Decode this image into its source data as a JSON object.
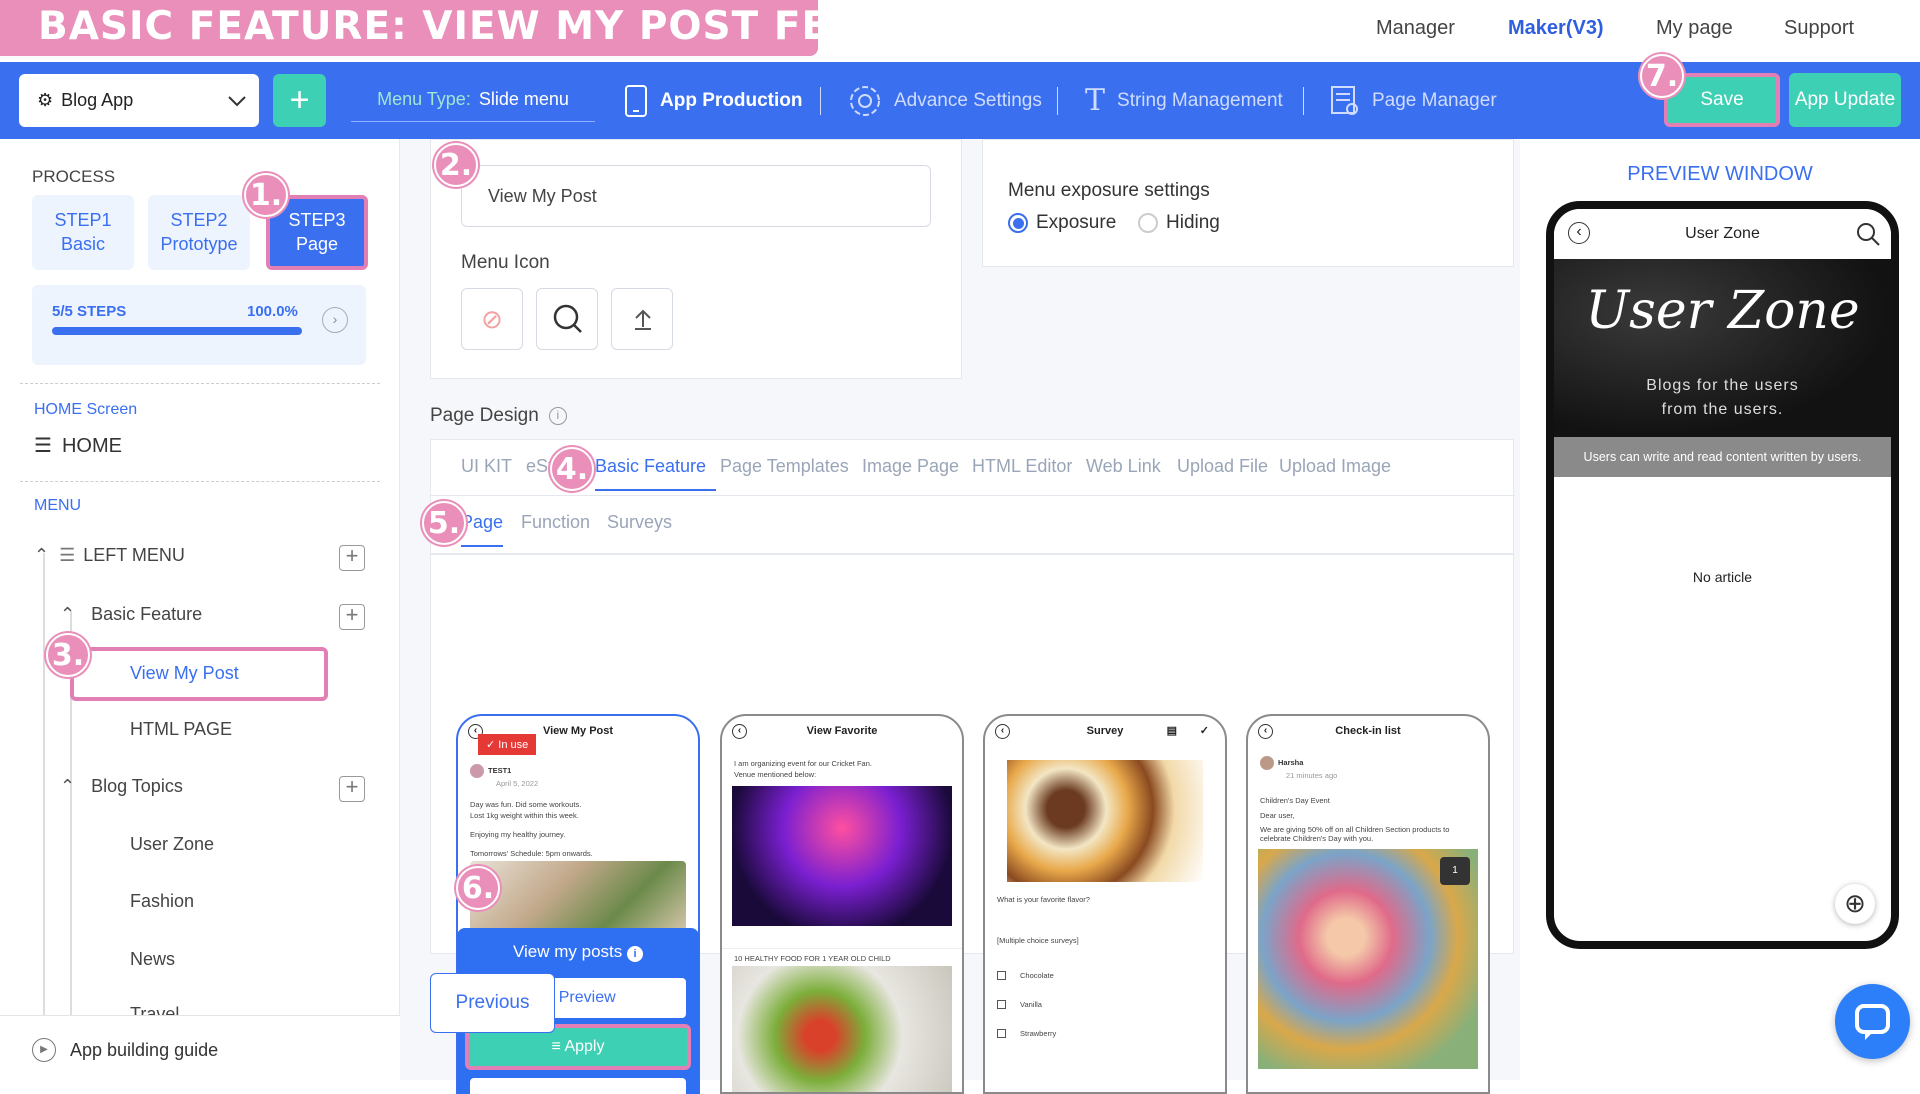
{
  "banner": {
    "title": "BASIC FEATURE: VIEW MY POST FEATURE"
  },
  "topnav": {
    "manager": "Manager",
    "maker": "Maker(V3)",
    "mypage": "My page",
    "support": "Support"
  },
  "toolbar": {
    "app_name": "Blog App",
    "add": "+",
    "menu_type_label": "Menu Type:",
    "menu_type_value": "Slide menu",
    "app_production": "App Production",
    "advance_settings": "Advance Settings",
    "string_management": "String Management",
    "page_manager": "Page Manager",
    "save": "Save",
    "app_update": "App Update"
  },
  "badges": [
    "1.",
    "2.",
    "3.",
    "4.",
    "5.",
    "6.",
    "7."
  ],
  "sidebar": {
    "process_label": "PROCESS",
    "steps": [
      {
        "line1": "STEP1",
        "line2": "Basic"
      },
      {
        "line1": "STEP2",
        "line2": "Prototype"
      },
      {
        "line1": "STEP3",
        "line2": "Page"
      }
    ],
    "progress_label": "5/5 STEPS",
    "progress_percent": "100.0%",
    "progress_value": 1.0,
    "home_screen_label": "HOME Screen",
    "home": "HOME",
    "menu_label": "MENU",
    "left_menu": "LEFT MENU",
    "basic_feature": "Basic Feature",
    "items": [
      "View My Post",
      "HTML PAGE"
    ],
    "blog_topics": "Blog Topics",
    "topic_items": [
      "User Zone",
      "Fashion",
      "News",
      "Travel"
    ],
    "guide": "App building guide"
  },
  "main": {
    "page_name_value": "View My Post",
    "menu_icon_label": "Menu Icon",
    "exposure_title": "Menu exposure settings",
    "exposure_options": [
      "Exposure",
      "Hiding"
    ],
    "page_design_label": "Page Design",
    "design_tabs": [
      "UI KIT",
      "eSt",
      "Basic Feature",
      "Page Templates",
      "Image Page",
      "HTML Editor",
      "Web Link",
      "Upload File",
      "Upload Image"
    ],
    "sub_tabs": [
      "Page",
      "Function",
      "Surveys"
    ],
    "previous": "Previous"
  },
  "cards": [
    {
      "title": "View My Post",
      "badge": "In use",
      "user": "TEST1",
      "date": "April 5, 2022",
      "lines": [
        "Day was fun. Did some workouts.",
        "Lost 1kg weight within this week.",
        "Enjoying my healthy journey.",
        "Tomorrows' Schedule: 5pm onwards."
      ],
      "overlay_title": "View my posts",
      "preview": "Preview",
      "apply": "Apply"
    },
    {
      "title": "View Favorite",
      "lines": [
        "I am organizing event for our Cricket Fan.",
        "Venue mentioned below:"
      ],
      "caption": "10 HEALTHY FOOD FOR 1 YEAR OLD CHILD"
    },
    {
      "title": "Survey",
      "question": "What is your favorite flavor?",
      "type": "[Multiple choice surveys]",
      "options": [
        "Chocolate",
        "Vanilla",
        "Strawberry"
      ]
    },
    {
      "title": "Check-in list",
      "user": "Harsha",
      "date": "21 minutes ago",
      "lines": [
        "Children's Day Event",
        "Dear user,",
        "We are giving 50% off on all Children Section products to celebrate Children's Day with you."
      ],
      "count": "1"
    }
  ],
  "preview": {
    "title": "PREVIEW WINDOW",
    "header": "User Zone",
    "hero_script": "User Zone",
    "hero_line1": "Blogs for the users",
    "hero_line2": "from the users.",
    "subtitle": "Users can write and read content written by users.",
    "empty": "No article"
  },
  "colors": {
    "brand_blue": "#3a6ff0",
    "green": "#3ed0b4",
    "pink": "#e98fb9"
  }
}
